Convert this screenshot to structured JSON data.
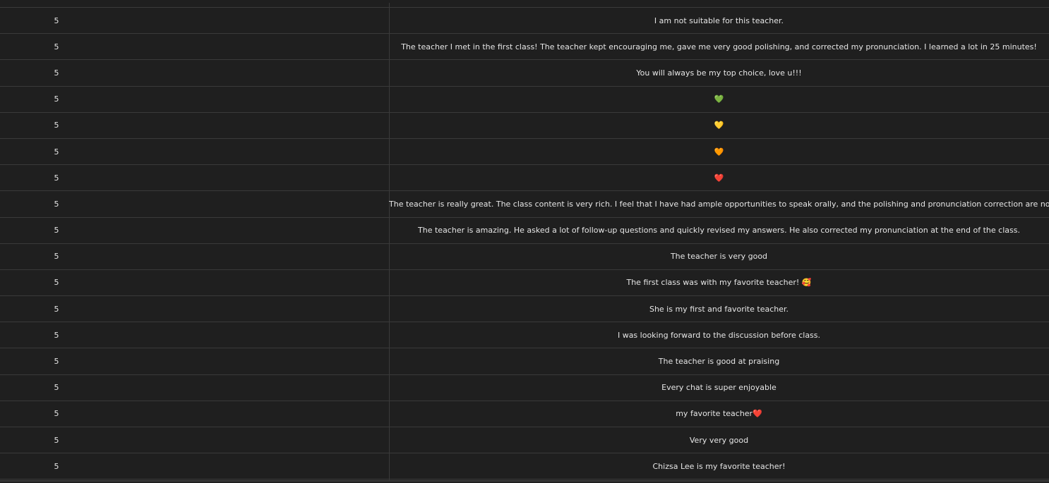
{
  "table": {
    "rows": [
      {
        "rating": "5",
        "review": "I am not suitable for this teacher."
      },
      {
        "rating": "5",
        "review": "The teacher I met in the first class! The teacher kept encouraging me, gave me very good polishing, and corrected my pronunciation. I learned a lot in 25 minutes!"
      },
      {
        "rating": "5",
        "review": "You will always be my top choice, love u!!!"
      },
      {
        "rating": "5",
        "review": "💚"
      },
      {
        "rating": "5",
        "review": "💛"
      },
      {
        "rating": "5",
        "review": "🧡"
      },
      {
        "rating": "5",
        "review": "❤️"
      },
      {
        "rating": "5",
        "review": "The teacher is really great. The class content is very rich. I feel that I have had ample opportunities to speak orally, and the polishing and pronunciation correction are not missed."
      },
      {
        "rating": "5",
        "review": "The teacher is amazing. He asked a lot of follow-up questions and quickly revised my answers. He also corrected my pronunciation at the end of the class."
      },
      {
        "rating": "5",
        "review": "The teacher is very good"
      },
      {
        "rating": "5",
        "review": "The first class was with my favorite teacher! 🥰"
      },
      {
        "rating": "5",
        "review": "She is my first and favorite teacher."
      },
      {
        "rating": "5",
        "review": "I was looking forward to the discussion before class."
      },
      {
        "rating": "5",
        "review": "The teacher is good at praising"
      },
      {
        "rating": "5",
        "review": "Every chat is super enjoyable"
      },
      {
        "rating": "5",
        "review": "my favorite teacher❤️"
      },
      {
        "rating": "5",
        "review": "Very very good"
      },
      {
        "rating": "5",
        "review": "Chizsa Lee is my favorite teacher!"
      }
    ]
  }
}
